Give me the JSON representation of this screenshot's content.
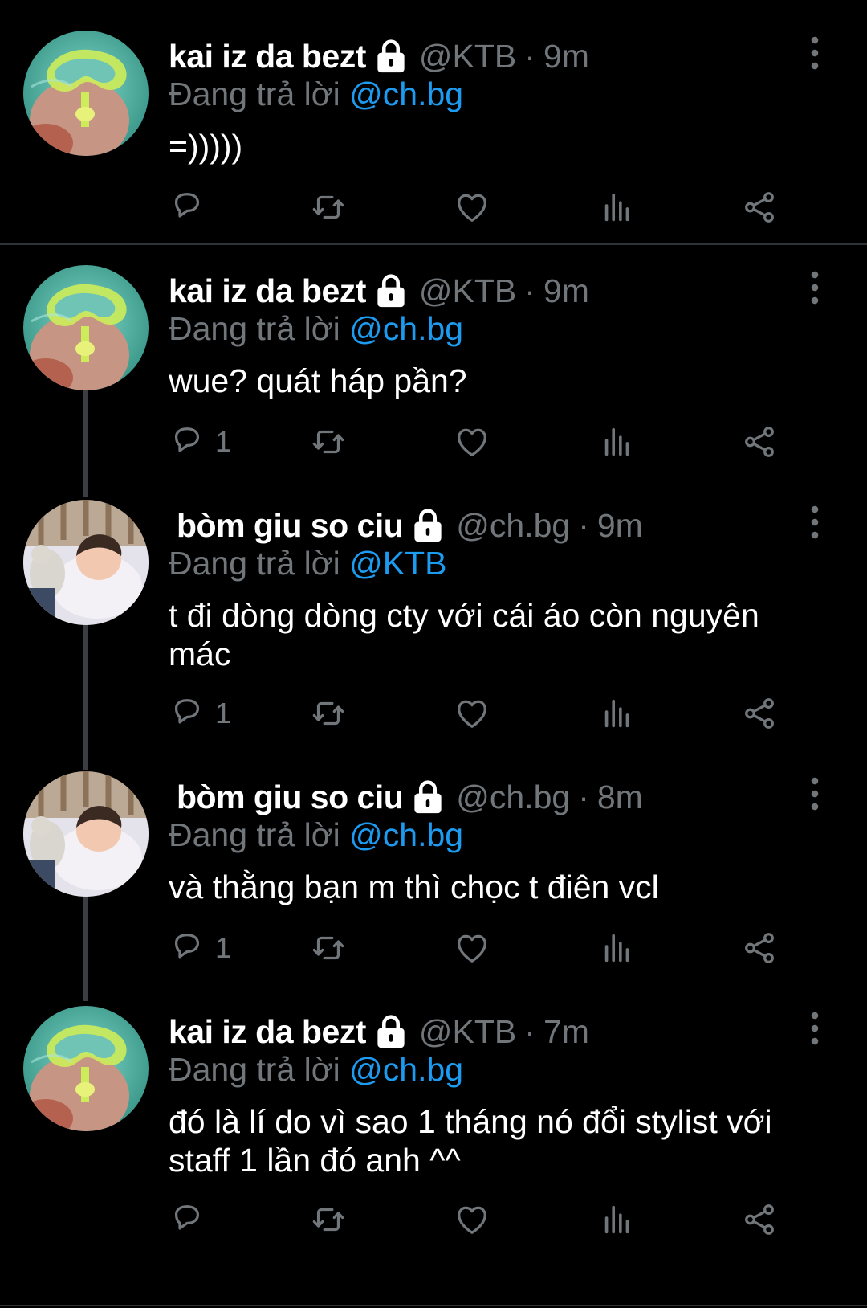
{
  "tweets": [
    {
      "name": "kai iz da bezt",
      "handle": "@KTB",
      "dot": "·",
      "time": "9m",
      "replying_label": "Đang trả lời",
      "replying_to": "@ch.bg",
      "text": "=)))))",
      "reply_count": "",
      "avatar": "snorkel-mask-avatar"
    },
    {
      "name": "kai iz da bezt",
      "handle": "@KTB",
      "dot": "·",
      "time": "9m",
      "replying_label": "Đang trả lời",
      "replying_to": "@ch.bg",
      "text": "wue? quát háp pần?",
      "reply_count": "1",
      "avatar": "snorkel-mask-avatar"
    },
    {
      "name": "bòm giu so ciu",
      "handle": "@ch.bg",
      "dot": "·",
      "time": "9m",
      "replying_label": "Đang trả lời",
      "replying_to": "@KTB",
      "text": "t đi dòng dòng cty với cái áo còn nguyên mác",
      "reply_count": "1",
      "avatar": "sleeping-baby-avatar"
    },
    {
      "name": "bòm giu so ciu",
      "handle": "@ch.bg",
      "dot": "·",
      "time": "8m",
      "replying_label": "Đang trả lời",
      "replying_to": "@ch.bg",
      "text": "và thằng bạn m thì chọc t điên vcl",
      "reply_count": "1",
      "avatar": "sleeping-baby-avatar"
    },
    {
      "name": "kai iz da bezt",
      "handle": "@KTB",
      "dot": "·",
      "time": "7m",
      "replying_label": "Đang trả lời",
      "replying_to": "@ch.bg",
      "text": "đó là lí do vì sao 1 tháng nó đổi stylist với staff 1 lần đó anh ^^",
      "reply_count": "",
      "avatar": "snorkel-mask-avatar"
    }
  ],
  "icons": {
    "lock": "lock-icon",
    "more": "more-vertical-icon",
    "reply": "reply-icon",
    "retweet": "retweet-icon",
    "like": "heart-icon",
    "views": "analytics-icon",
    "share": "share-icon"
  },
  "colors": {
    "background": "#000000",
    "text_primary": "#ffffff",
    "text_secondary": "#71767b",
    "link": "#1d9bf0",
    "divider": "#2f3336",
    "thread_line": "#3a3d41"
  }
}
